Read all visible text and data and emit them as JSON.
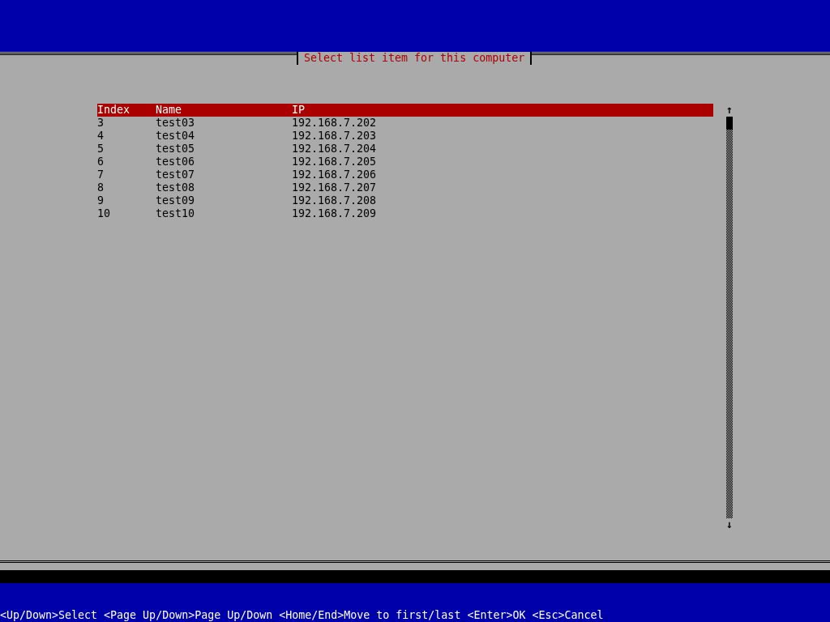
{
  "dialog": {
    "title": "Select list item for this computer"
  },
  "table": {
    "columns": [
      "Index",
      "Name",
      "IP"
    ],
    "rows": [
      [
        "3",
        "test03",
        "192.168.7.202"
      ],
      [
        "4",
        "test04",
        "192.168.7.203"
      ],
      [
        "5",
        "test05",
        "192.168.7.204"
      ],
      [
        "6",
        "test06",
        "192.168.7.205"
      ],
      [
        "7",
        "test07",
        "192.168.7.206"
      ],
      [
        "8",
        "test08",
        "192.168.7.207"
      ],
      [
        "9",
        "test09",
        "192.168.7.208"
      ],
      [
        "10",
        "test10",
        "192.168.7.209"
      ]
    ]
  },
  "scrollbar": {
    "up": "↑",
    "down": "↓"
  },
  "status_bar": "<Up/Down>Select <Page Up/Down>Page Up/Down <Home/End>Move to first/last <Enter>OK <Esc>Cancel"
}
